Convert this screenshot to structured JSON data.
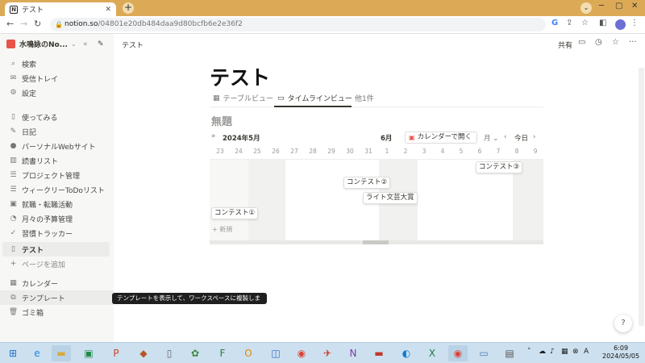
{
  "browser": {
    "tab_title": "テスト",
    "tab_favicon": "N",
    "url_host": "notion.so",
    "url_path": "/04801e20db484daa9d80bcfb6e2e36f2"
  },
  "sidebar": {
    "workspace": "水鳴詠のNo...",
    "group1": [
      {
        "icon": "⌕",
        "label": "検索"
      },
      {
        "icon": "✉",
        "label": "受信トレイ"
      },
      {
        "icon": "⚙",
        "label": "設定"
      }
    ],
    "pages": [
      {
        "icon": "▯",
        "label": "使ってみる"
      },
      {
        "icon": "✎",
        "label": "日記"
      },
      {
        "icon": "●",
        "label": "パーソナルWebサイト"
      },
      {
        "icon": "▥",
        "label": "読書リスト"
      },
      {
        "icon": "☰",
        "label": "プロジェクト管理"
      },
      {
        "icon": "☰",
        "label": "ウィークリーToDoリスト"
      },
      {
        "icon": "▣",
        "label": "就職・転職活動"
      },
      {
        "icon": "◔",
        "label": "月々の予算管理"
      },
      {
        "icon": "✓",
        "label": "習慣トラッカー"
      },
      {
        "icon": "▯",
        "label": "テスト"
      }
    ],
    "add_page": "ページを追加",
    "group3": [
      {
        "icon": "▦",
        "label": "カレンダー"
      },
      {
        "icon": "⧉",
        "label": "テンプレート"
      },
      {
        "icon": "🗑",
        "label": "ゴミ箱"
      }
    ],
    "tooltip": "テンプレートを表示して、ワークスペースに複製します。"
  },
  "topbar": {
    "breadcrumb": "テスト",
    "share": "共有"
  },
  "page": {
    "title": "テスト",
    "tabs": [
      {
        "icon": "▦",
        "label": "テーブルビュー"
      },
      {
        "icon": "▭",
        "label": "タイムラインビュー"
      },
      {
        "icon": "",
        "label": "他1件"
      }
    ],
    "db_title": "無題"
  },
  "timeline": {
    "month_left": "2024年5月",
    "month_right": "6月",
    "open_calendar": "カレンダーで開く",
    "scale": "月",
    "today": "今日",
    "days": [
      "23",
      "24",
      "25",
      "26",
      "27",
      "28",
      "29",
      "30",
      "31",
      "1",
      "2",
      "3",
      "4",
      "5",
      "6",
      "7",
      "8",
      "9"
    ],
    "cards": [
      {
        "label": "コンテスト③"
      },
      {
        "label": "コンテスト②"
      },
      {
        "label": "ライト文芸大賞"
      },
      {
        "label": "コンテスト①"
      }
    ],
    "new_label": "新規"
  },
  "help": "?",
  "clock": {
    "time": "6:09",
    "date": "2024/05/05"
  }
}
